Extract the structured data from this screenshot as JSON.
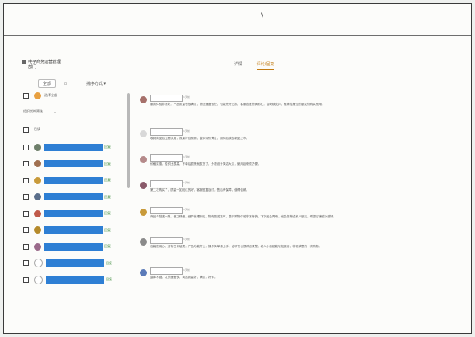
{
  "header": {
    "title_line1": "电子商务运营管理",
    "title_line2": "部门",
    "cursor_glyph": "\\"
  },
  "tabs": [
    {
      "label": "详情"
    },
    {
      "label": "评论/回复"
    }
  ],
  "toolbar": {
    "filter_label": "全部",
    "select_value": "排序方式"
  },
  "sidebar": {
    "all_label": "全选",
    "group_label": "选择全部",
    "group_sub": "组织架构筛选",
    "group_caret": "▾",
    "count_label": "已读",
    "members": [
      {
        "tag": "回复",
        "color": "#6e7f6a"
      },
      {
        "tag": "回复",
        "color": "#a07050"
      },
      {
        "tag": "回复",
        "color": "#c89a3a"
      },
      {
        "tag": "回复",
        "color": "#5a6e8a"
      },
      {
        "tag": "回复",
        "color": "#c05a4a"
      },
      {
        "tag": "回复",
        "color": "#b58a2a"
      },
      {
        "tag": "回复",
        "color": "#9a6a8a"
      },
      {
        "tag": "回复",
        "color": "#ffffff"
      },
      {
        "tag": "回复",
        "color": "#ffffff"
      }
    ]
  },
  "posts": [
    {
      "time": "1天前",
      "color": "#a6706a",
      "text": "服务体验非常好，产品质量也很满意，物流速度很快，包装完好无损，客服态度热情耐心，会继续支持，推荐给身边的朋友们购买使用。"
    },
    {
      "time": "1天前",
      "color": "#d8d8d8",
      "text": "收到商品后立即试用，效果符合预期，整体评价满意，期待后续的新品上市。"
    },
    {
      "time": "1天前",
      "color": "#b58a8a",
      "text": "价格实惠，性价比很高，下单后很快就发货了，外观设计简洁大方，使用起来很方便。"
    },
    {
      "time": "1天前",
      "color": "#8a5a6a",
      "text": "第二次购买了，质量一如既往的好，客服回复及时，售后有保障，值得信赖。"
    },
    {
      "time": "1天前",
      "color": "#c89a3a",
      "text": "商品与描述一致，做工精细，细节处理到位，物流配送准时，整体购物体验非常愉快，下次还会再来，也会推荐给家人朋友，希望店铺越办越好。"
    },
    {
      "time": "1天前",
      "color": "#8a8a8a",
      "text": "包装很用心，没有任何破损，产品功能齐全，操作简单易上手，说明书也很详细清楚，老人小孩都能轻松使用，非常满意的一次购物。"
    },
    {
      "time": "1天前",
      "color": "#5a7ab8",
      "text": "整体不错，发货速度快，商品质量好，满意，好评。"
    }
  ]
}
